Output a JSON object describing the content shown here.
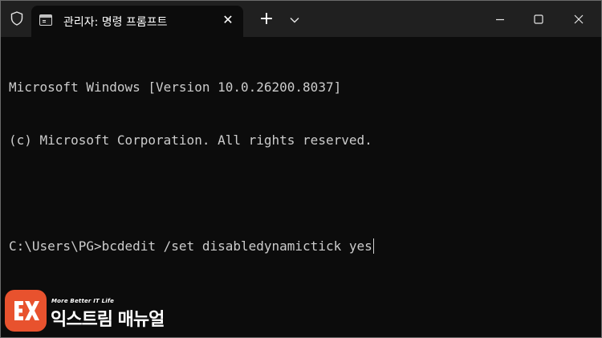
{
  "window": {
    "tab_title": "관리자: 명령 프롬프트",
    "icons": {
      "shield": "shield-icon",
      "tab": "terminal-icon",
      "tab_close": "close-icon",
      "new_tab": "plus-icon",
      "dropdown": "chevron-down-icon",
      "minimize": "minimize-icon",
      "maximize": "maximize-icon",
      "close": "close-icon"
    },
    "tab_close_glyph": "✕",
    "new_tab_glyph": "+"
  },
  "terminal": {
    "lines": [
      "Microsoft Windows [Version 10.0.26200.8037]",
      "(c) Microsoft Corporation. All rights reserved.",
      "",
      "C:\\Users\\PG>bcdedit /set disabledynamictick yes"
    ]
  },
  "watermark": {
    "tagline": "More Better IT Life",
    "name": "익스트림 매뉴얼",
    "logo_color": "#e8522e"
  },
  "colors": {
    "titlebar": "#202020",
    "terminal_bg": "#0c0c0c",
    "text": "#cccccc"
  }
}
